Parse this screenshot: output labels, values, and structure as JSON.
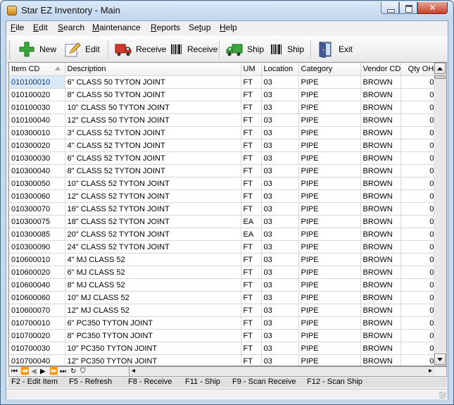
{
  "window": {
    "title": "Star EZ Inventory - Main"
  },
  "menu": [
    {
      "u": "F",
      "rest": "ile"
    },
    {
      "u": "E",
      "rest": "dit"
    },
    {
      "u": "S",
      "rest": "earch"
    },
    {
      "u": "M",
      "rest": "aintenance"
    },
    {
      "u": "R",
      "rest": "eports"
    },
    {
      "u": "",
      "pre": "Se",
      "u2": "t",
      "rest": "up"
    },
    {
      "u": "H",
      "rest": "elp"
    }
  ],
  "toolbar": {
    "new_label": "New",
    "edit_label": "Edit",
    "receive_label": "Receive",
    "scan_receive_label": "Receive",
    "ship_label": "Ship",
    "scan_ship_label": "Ship",
    "exit_label": "Exit"
  },
  "grid": {
    "columns": [
      "Item CD",
      "Description",
      "UM",
      "Location",
      "Category",
      "Vendor CD",
      "Qty OH"
    ],
    "rows": [
      [
        "010100010",
        "6\" CLASS 50 TYTON JOINT",
        "FT",
        "03",
        "PIPE",
        "BROWN",
        "0"
      ],
      [
        "010100020",
        "8\" CLASS 50 TYTON JOINT",
        "FT",
        "03",
        "PIPE",
        "BROWN",
        "0"
      ],
      [
        "010100030",
        "10\" CLASS 50 TYTON JOINT",
        "FT",
        "03",
        "PIPE",
        "BROWN",
        "0"
      ],
      [
        "010100040",
        "12\" CLASS 50 TYTON JOINT",
        "FT",
        "03",
        "PIPE",
        "BROWN",
        "0"
      ],
      [
        "010300010",
        "3\" CLASS 52 TYTON JOINT",
        "FT",
        "03",
        "PIPE",
        "BROWN",
        "0"
      ],
      [
        "010300020",
        "4\" CLASS 52 TYTON JOINT",
        "FT",
        "03",
        "PIPE",
        "BROWN",
        "0"
      ],
      [
        "010300030",
        "6\" CLASS 52 TYTON JOINT",
        "FT",
        "03",
        "PIPE",
        "BROWN",
        "0"
      ],
      [
        "010300040",
        "8\" CLASS 52 TYTON JOINT",
        "FT",
        "03",
        "PIPE",
        "BROWN",
        "0"
      ],
      [
        "010300050",
        "10\" CLASS 52 TYTON JOINT",
        "FT",
        "03",
        "PIPE",
        "BROWN",
        "0"
      ],
      [
        "010300060",
        "12\" CLASS 52 TYTON JOINT",
        "FT",
        "03",
        "PIPE",
        "BROWN",
        "0"
      ],
      [
        "010300070",
        "16\" CLASS 52 TYTON JOINT",
        "FT",
        "03",
        "PIPE",
        "BROWN",
        "0"
      ],
      [
        "010300075",
        "18\" CLASS 52 TYTON JOINT",
        "EA",
        "03",
        "PIPE",
        "BROWN",
        "0"
      ],
      [
        "010300085",
        "20\" CLASS 52 TYTON JOINT",
        "EA",
        "03",
        "PIPE",
        "BROWN",
        "0"
      ],
      [
        "010300090",
        "24\" CLASS 52 TYTON JOINT",
        "FT",
        "03",
        "PIPE",
        "BROWN",
        "0"
      ],
      [
        "010600010",
        "4\" MJ CLASS 52",
        "FT",
        "03",
        "PIPE",
        "BROWN",
        "0"
      ],
      [
        "010600020",
        "6\" MJ CLASS 52",
        "FT",
        "03",
        "PIPE",
        "BROWN",
        "0"
      ],
      [
        "010600040",
        "8\" MJ CLASS 52",
        "FT",
        "03",
        "PIPE",
        "BROWN",
        "0"
      ],
      [
        "010600060",
        "10\" MJ CLASS 52",
        "FT",
        "03",
        "PIPE",
        "BROWN",
        "0"
      ],
      [
        "010600070",
        "12\" MJ CLASS 52",
        "FT",
        "03",
        "PIPE",
        "BROWN",
        "0"
      ],
      [
        "010700010",
        "6\" PC350 TYTON JOINT",
        "FT",
        "03",
        "PIPE",
        "BROWN",
        "0"
      ],
      [
        "010700020",
        "8\" PC350 TYTON JOINT",
        "FT",
        "03",
        "PIPE",
        "BROWN",
        "0"
      ],
      [
        "010700030",
        "10\" PC350 TYTON JOINT",
        "FT",
        "03",
        "PIPE",
        "BROWN",
        "0"
      ],
      [
        "010700040",
        "12\" PC350 TYTON JOINT",
        "FT",
        "03",
        "PIPE",
        "BROWN",
        "0"
      ]
    ]
  },
  "status": {
    "f2": "F2 - Edit Item",
    "f5": "F5 - Refresh",
    "f8": "F8 - Receive",
    "f11": "F11 - Ship",
    "f9": "F9 - Scan Receive",
    "f12": "F12 - Scan Ship"
  }
}
